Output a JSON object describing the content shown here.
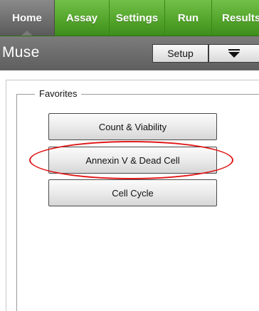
{
  "tabs": [
    {
      "label": "Home",
      "active": true
    },
    {
      "label": "Assay",
      "active": false
    },
    {
      "label": "Settings",
      "active": false
    },
    {
      "label": "Run",
      "active": false
    },
    {
      "label": "Results",
      "active": false
    }
  ],
  "header": {
    "title": "Muse",
    "setup_label": "Setup",
    "menu_icon": "menu-down-icon"
  },
  "favorites": {
    "legend": "Favorites",
    "items": [
      {
        "label": "Count & Viability"
      },
      {
        "label": "Annexin V & Dead Cell",
        "highlighted": true
      },
      {
        "label": "Cell Cycle"
      }
    ]
  },
  "colors": {
    "tab_green": "#54a52b",
    "home_tab_gray": "#6d6d6d",
    "titlebar_gray": "#6b6b6b",
    "highlight_red": "#e01818"
  }
}
